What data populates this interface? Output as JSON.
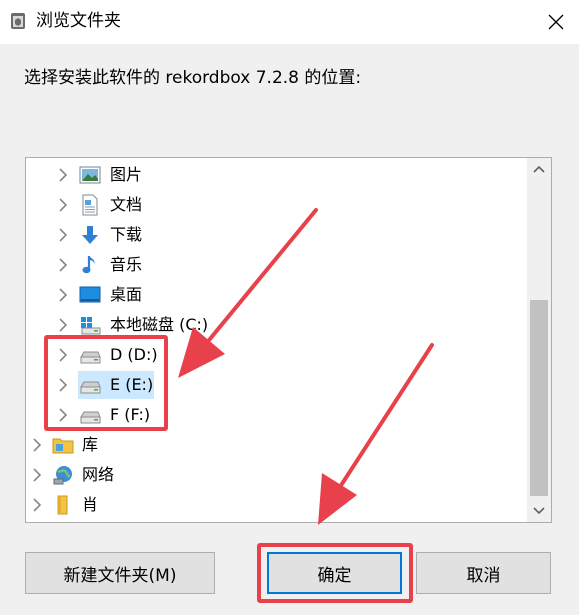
{
  "window": {
    "title": "浏览文件夹",
    "title_icon": "app-folder-icon",
    "close_icon": "close-icon"
  },
  "prompt": "选择安装此软件的 rekordbox 7.2.8 的位置:",
  "tree": {
    "items": [
      {
        "label": "图片",
        "icon": "pictures-icon",
        "level": 1,
        "selected": false
      },
      {
        "label": "文档",
        "icon": "documents-icon",
        "level": 1,
        "selected": false
      },
      {
        "label": "下载",
        "icon": "downloads-icon",
        "level": 1,
        "selected": false
      },
      {
        "label": "音乐",
        "icon": "music-icon",
        "level": 1,
        "selected": false
      },
      {
        "label": "桌面",
        "icon": "desktop-icon",
        "level": 1,
        "selected": false
      },
      {
        "label": "本地磁盘 (C:)",
        "icon": "system-drive-icon",
        "level": 1,
        "selected": false
      },
      {
        "label": "D (D:)",
        "icon": "drive-icon",
        "level": 1,
        "selected": false
      },
      {
        "label": "E (E:)",
        "icon": "drive-icon",
        "level": 1,
        "selected": true
      },
      {
        "label": "F (F:)",
        "icon": "drive-icon",
        "level": 1,
        "selected": false
      },
      {
        "label": "库",
        "icon": "library-icon",
        "level": 0,
        "selected": false
      },
      {
        "label": "网络",
        "icon": "network-icon",
        "level": 0,
        "selected": false
      },
      {
        "label": "肖",
        "icon": "user-folder-icon",
        "level": 0,
        "selected": false
      }
    ]
  },
  "buttons": {
    "new_folder": "新建文件夹(M)",
    "ok": "确定",
    "cancel": "取消"
  },
  "colors": {
    "highlight": "#e8414b",
    "selection": "#cce8ff",
    "accent": "#0078d7"
  }
}
